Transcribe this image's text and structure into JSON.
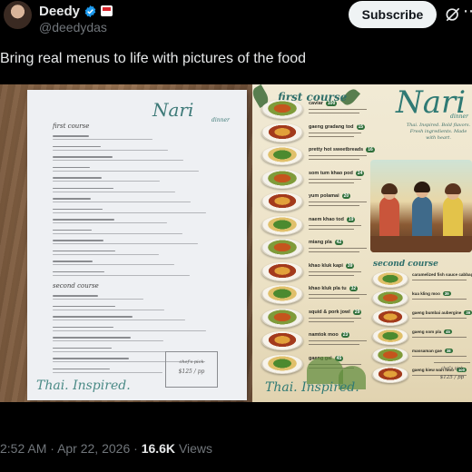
{
  "author": {
    "display_name": "Deedy",
    "handle": "@deedydas",
    "subscribe_label": "Subscribe"
  },
  "post": {
    "text": "Bring real menus to life with pictures of the food"
  },
  "media": {
    "plain_menu": {
      "title": "Nari",
      "subtitle": "dinner",
      "first_course_label": "first course",
      "second_course_label": "second course",
      "footer_text": "Thai. Inspired.",
      "chef_pick_label": "chef's pick",
      "chef_pick_price": "$125 / pp"
    },
    "illustrated_menu": {
      "title": "Nari",
      "subtitle": "dinner",
      "tagline": "Thai. Inspired. Bold flavors. Fresh ingredients. Made with heart.",
      "first_course_label": "first course",
      "second_course_label": "second course",
      "footer_text": "Thai. Inspired.",
      "chef_pick_label": "chef's pick",
      "chef_pick_price": "$125 / pp",
      "first_course_items": [
        {
          "name": "caviar",
          "price": "100"
        },
        {
          "name": "gaeng gradang tod",
          "price": "15"
        },
        {
          "name": "pretty hot sweetbreads",
          "price": "16"
        },
        {
          "name": "som tum khao pod",
          "price": "24"
        },
        {
          "name": "yum polamai",
          "price": "20"
        },
        {
          "name": "naem khao tod",
          "price": "19"
        },
        {
          "name": "miang pla",
          "price": "42"
        },
        {
          "name": "khao kluk kapi",
          "price": "39"
        },
        {
          "name": "khao kluk pla tu",
          "price": "32"
        },
        {
          "name": "squid & pork jowl",
          "price": "29"
        },
        {
          "name": "namtok moo",
          "price": "23"
        },
        {
          "name": "gaeng gai",
          "price": "45"
        }
      ],
      "second_course_items": [
        {
          "name": "caramelized fish sauce cabbage",
          "price": "25"
        },
        {
          "name": "kua kling moo",
          "price": "39"
        },
        {
          "name": "gaeng bumbai aubergine",
          "price": "39"
        },
        {
          "name": "gaeng som pla",
          "price": "45"
        },
        {
          "name": "massaman gae",
          "price": "38"
        },
        {
          "name": "gaeng kiew wan moo",
          "price": "100"
        }
      ]
    }
  },
  "meta": {
    "time": "2:52 AM",
    "separator": "·",
    "date": "Apr 22, 2026",
    "views_count": "16.6K",
    "views_label": "Views"
  },
  "colors": {
    "background": "#000000",
    "text_primary": "#e7e9ea",
    "text_secondary": "#71767b",
    "verified": "#1d9bf0",
    "menu_teal": "#2f7a74"
  }
}
